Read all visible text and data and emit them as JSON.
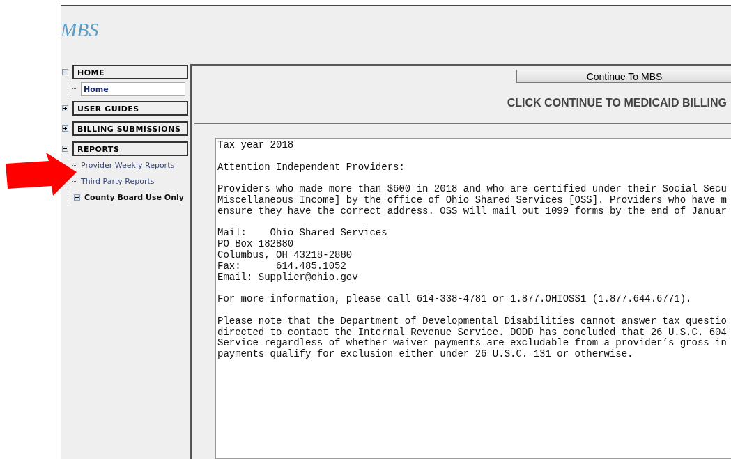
{
  "logo": "MBS",
  "sidebar": {
    "sections": [
      {
        "label": "HOME",
        "expanded": true,
        "children": [
          {
            "label": "Home",
            "kind": "link",
            "selected": true
          }
        ]
      },
      {
        "label": "USER GUIDES",
        "expanded": false
      },
      {
        "label": "BILLING SUBMISSIONS",
        "expanded": false
      },
      {
        "label": "REPORTS",
        "expanded": true,
        "children": [
          {
            "label": "Provider Weekly Reports",
            "kind": "link",
            "selected": false
          },
          {
            "label": "Third Party Reports",
            "kind": "link",
            "selected": false
          },
          {
            "label": "County Board Use Only",
            "kind": "folder",
            "expanded": false
          }
        ]
      }
    ]
  },
  "content": {
    "button": "Continue To MBS",
    "heading": "CLICK CONTINUE TO MEDICAID BILLING",
    "notice_paragraphs": [
      [
        "Tax year 2018"
      ],
      [
        "Attention Independent Providers:"
      ],
      [
        "Providers who made more than $600 in 2018 and who are certified under their Social Secu",
        "Miscellaneous Income] by the office of Ohio Shared Services [OSS]. Providers who have m",
        "ensure they have the correct address. OSS will mail out 1099 forms by the end of Januar"
      ],
      [
        "Mail:    Ohio Shared Services",
        "PO Box 182880",
        "Columbus, OH 43218-2880",
        "Fax:      614.485.1052",
        "Email: Supplier@ohio.gov"
      ],
      [
        "For more information, please call 614-338-4781 or 1.877.OHIOSS1 (1.877.644.6771)."
      ],
      [
        "Please note that the Department of Developmental Disabilities cannot answer tax questio",
        "directed to contact the Internal Revenue Service. DODD has concluded that 26 U.S.C. 604",
        "Service regardless of whether waiver payments are excludable from a provider’s gross in",
        "payments qualify for exclusion either under 26 U.S.C. 131 or otherwise."
      ]
    ]
  }
}
